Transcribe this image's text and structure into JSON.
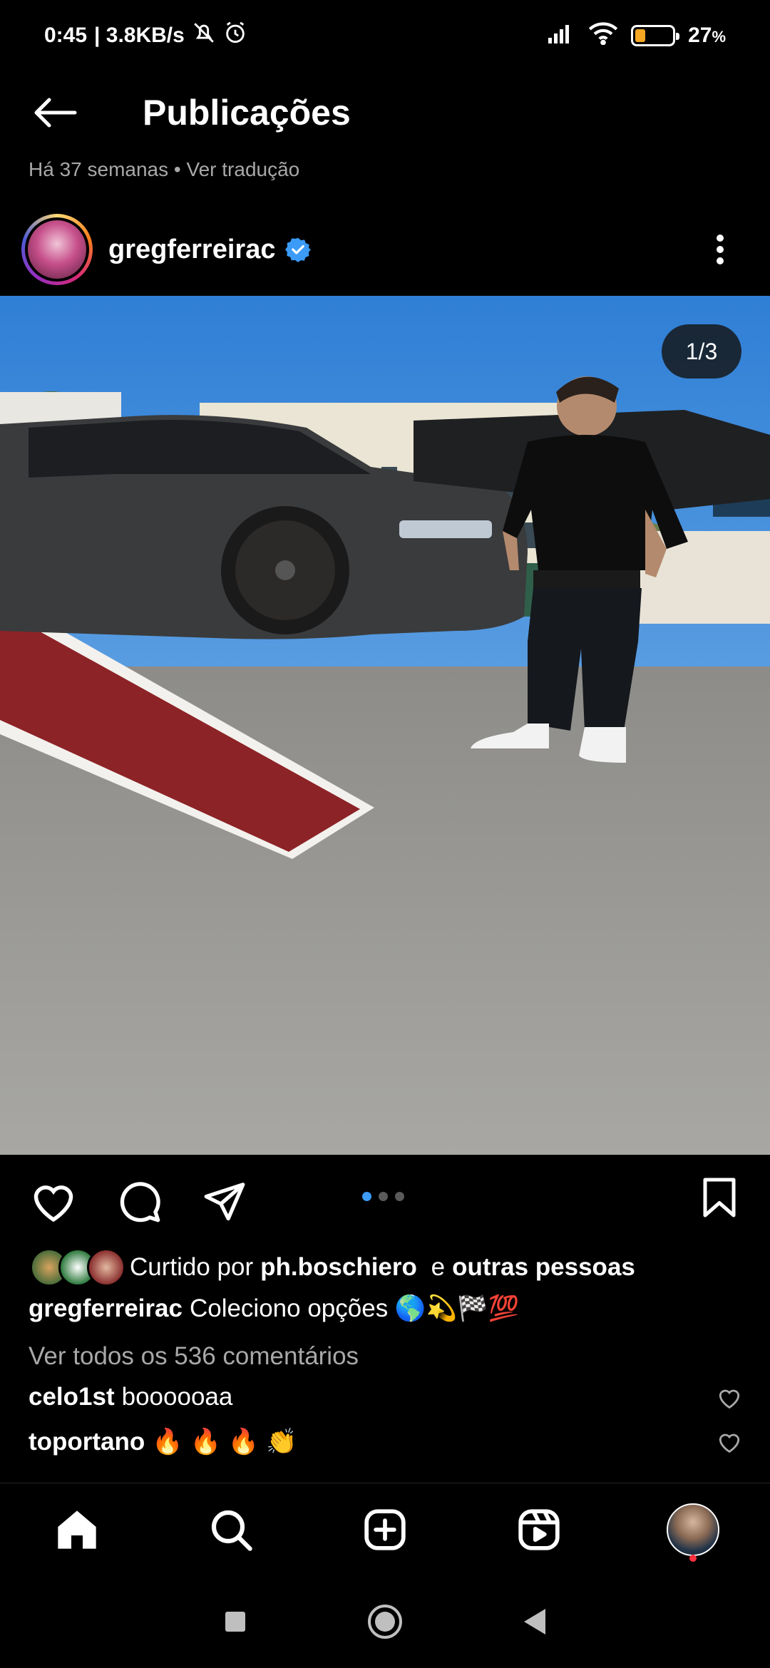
{
  "status_bar": {
    "time": "0:45",
    "net_speed": "| 3.8KB/s",
    "battery_percent": "27",
    "battery_suffix": "%",
    "battery_level": 0.27
  },
  "header": {
    "title": "Publicações"
  },
  "previous_post_meta": "Há 37 semanas • Ver tradução",
  "post": {
    "username": "gregferreirac",
    "verified": true,
    "media_counter": "1/3",
    "media_count": 3,
    "media_index": 1,
    "likes": {
      "prefix": "Curtido por",
      "user": "ph.boschiero",
      "connector": "e",
      "others": "outras pessoas"
    },
    "caption": {
      "username": "gregferreirac",
      "text": "Coleciono opções 🌎💫🏁💯"
    },
    "view_comments": "Ver todos os 536 comentários",
    "comments": [
      {
        "username": "celo1st",
        "text": "boooooaa"
      },
      {
        "username": "toportano",
        "text": "🔥 🔥 🔥 👏"
      }
    ]
  },
  "colors": {
    "background": "#000000",
    "accent_blue": "#3b9bf7",
    "secondary_text": "#a8a8a8",
    "notification": "#ff3040"
  },
  "icons": {
    "back": "arrow-left-icon",
    "more": "more-vertical-icon",
    "like": "heart-icon",
    "comment": "comment-icon",
    "share": "send-icon",
    "save": "bookmark-icon",
    "home": "home-icon",
    "search": "search-icon",
    "create": "add-post-icon",
    "reels": "reels-icon"
  }
}
